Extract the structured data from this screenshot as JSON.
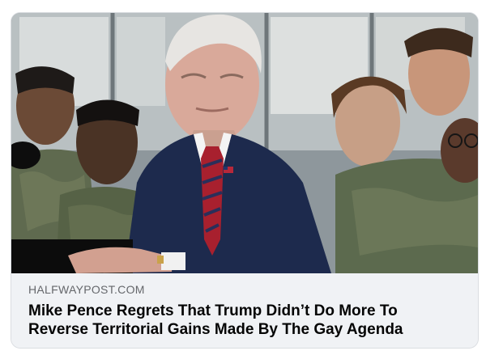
{
  "link_preview": {
    "domain": "HALFWAYPOST.COM",
    "headline_line1": "Mike Pence Regrets That Trump Didn’t Do More To",
    "headline_line2": "Reverse Territorial Gains Made By The Gay Agenda",
    "image": {
      "subject": "man in navy suit with red striped tie at podium, service members in camouflage uniforms in background"
    }
  }
}
